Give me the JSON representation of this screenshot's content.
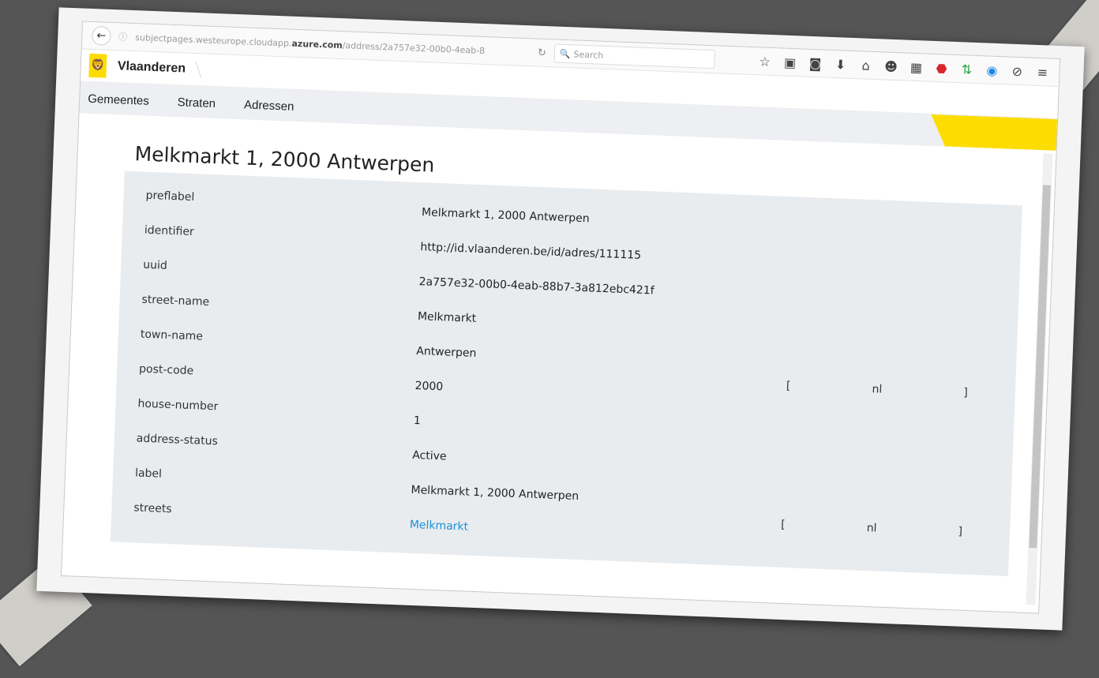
{
  "browser": {
    "url_prefix": "subjectpages.westeurope.cloudapp.",
    "url_host": "azure.com",
    "url_path": "/address/2a757e32-00b0-4eab-8",
    "search_placeholder": "Search",
    "icons": [
      "star-icon",
      "clipboard-icon",
      "pocket-icon",
      "download-icon",
      "home-icon",
      "emoji-icon",
      "grid-icon",
      "adblock-icon",
      "sync-icon",
      "skype-icon",
      "disable-icon",
      "menu-icon"
    ]
  },
  "site": {
    "brand": "Vlaanderen",
    "nav": [
      "Gemeentes",
      "Straten",
      "Adressen"
    ]
  },
  "page": {
    "title": "Melkmarkt 1, 2000 Antwerpen",
    "properties": [
      {
        "key": "preflabel",
        "value": "Melkmarkt 1, 2000 Antwerpen"
      },
      {
        "key": "identifier",
        "value": "http://id.vlaanderen.be/id/adres/111115"
      },
      {
        "key": "uuid",
        "value": "2a757e32-00b0-4eab-88b7-3a812ebc421f"
      },
      {
        "key": "street-name",
        "value": "Melkmarkt"
      },
      {
        "key": "town-name",
        "value": "Antwerpen"
      },
      {
        "key": "post-code",
        "value": "2000"
      },
      {
        "key": "house-number",
        "value": "1"
      },
      {
        "key": "address-status",
        "value": "Active"
      },
      {
        "key": "label",
        "value": "Melkmarkt 1, 2000 Antwerpen"
      },
      {
        "key": "streets",
        "value": "Melkmarkt"
      }
    ],
    "lang_tag": {
      "open": "[",
      "lang": "nl",
      "close": "]"
    }
  },
  "colors": {
    "brand_yellow": "#fddd00",
    "link_blue": "#1a8fd6",
    "panel_gray": "#e9ecef",
    "backdrop": "#555555"
  }
}
